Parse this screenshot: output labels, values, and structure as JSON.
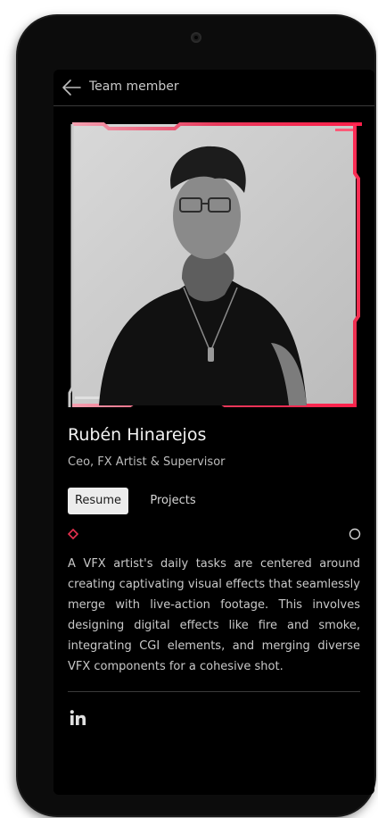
{
  "header": {
    "title": "Team member"
  },
  "profile": {
    "name": "Rubén Hinarejos",
    "role": "Ceo, FX Artist & Supervisor",
    "photo_alt": "Black and white portrait"
  },
  "tabs": [
    {
      "label": "Resume",
      "active": true
    },
    {
      "label": "Projects",
      "active": false
    }
  ],
  "progress": {
    "value": 0
  },
  "bio": "A VFX artist's daily tasks are centered around creating captivating visual effects that seamlessly merge with live-action footage. This involves designing digital effects like fire and smoke, integrating CGI elements, and merging diverse VFX components for a cohesive shot.",
  "social": [
    {
      "icon": "linkedin-icon"
    }
  ],
  "colors": {
    "accent": "#e8314f",
    "background": "#000000",
    "text": "#c9c9c9"
  }
}
